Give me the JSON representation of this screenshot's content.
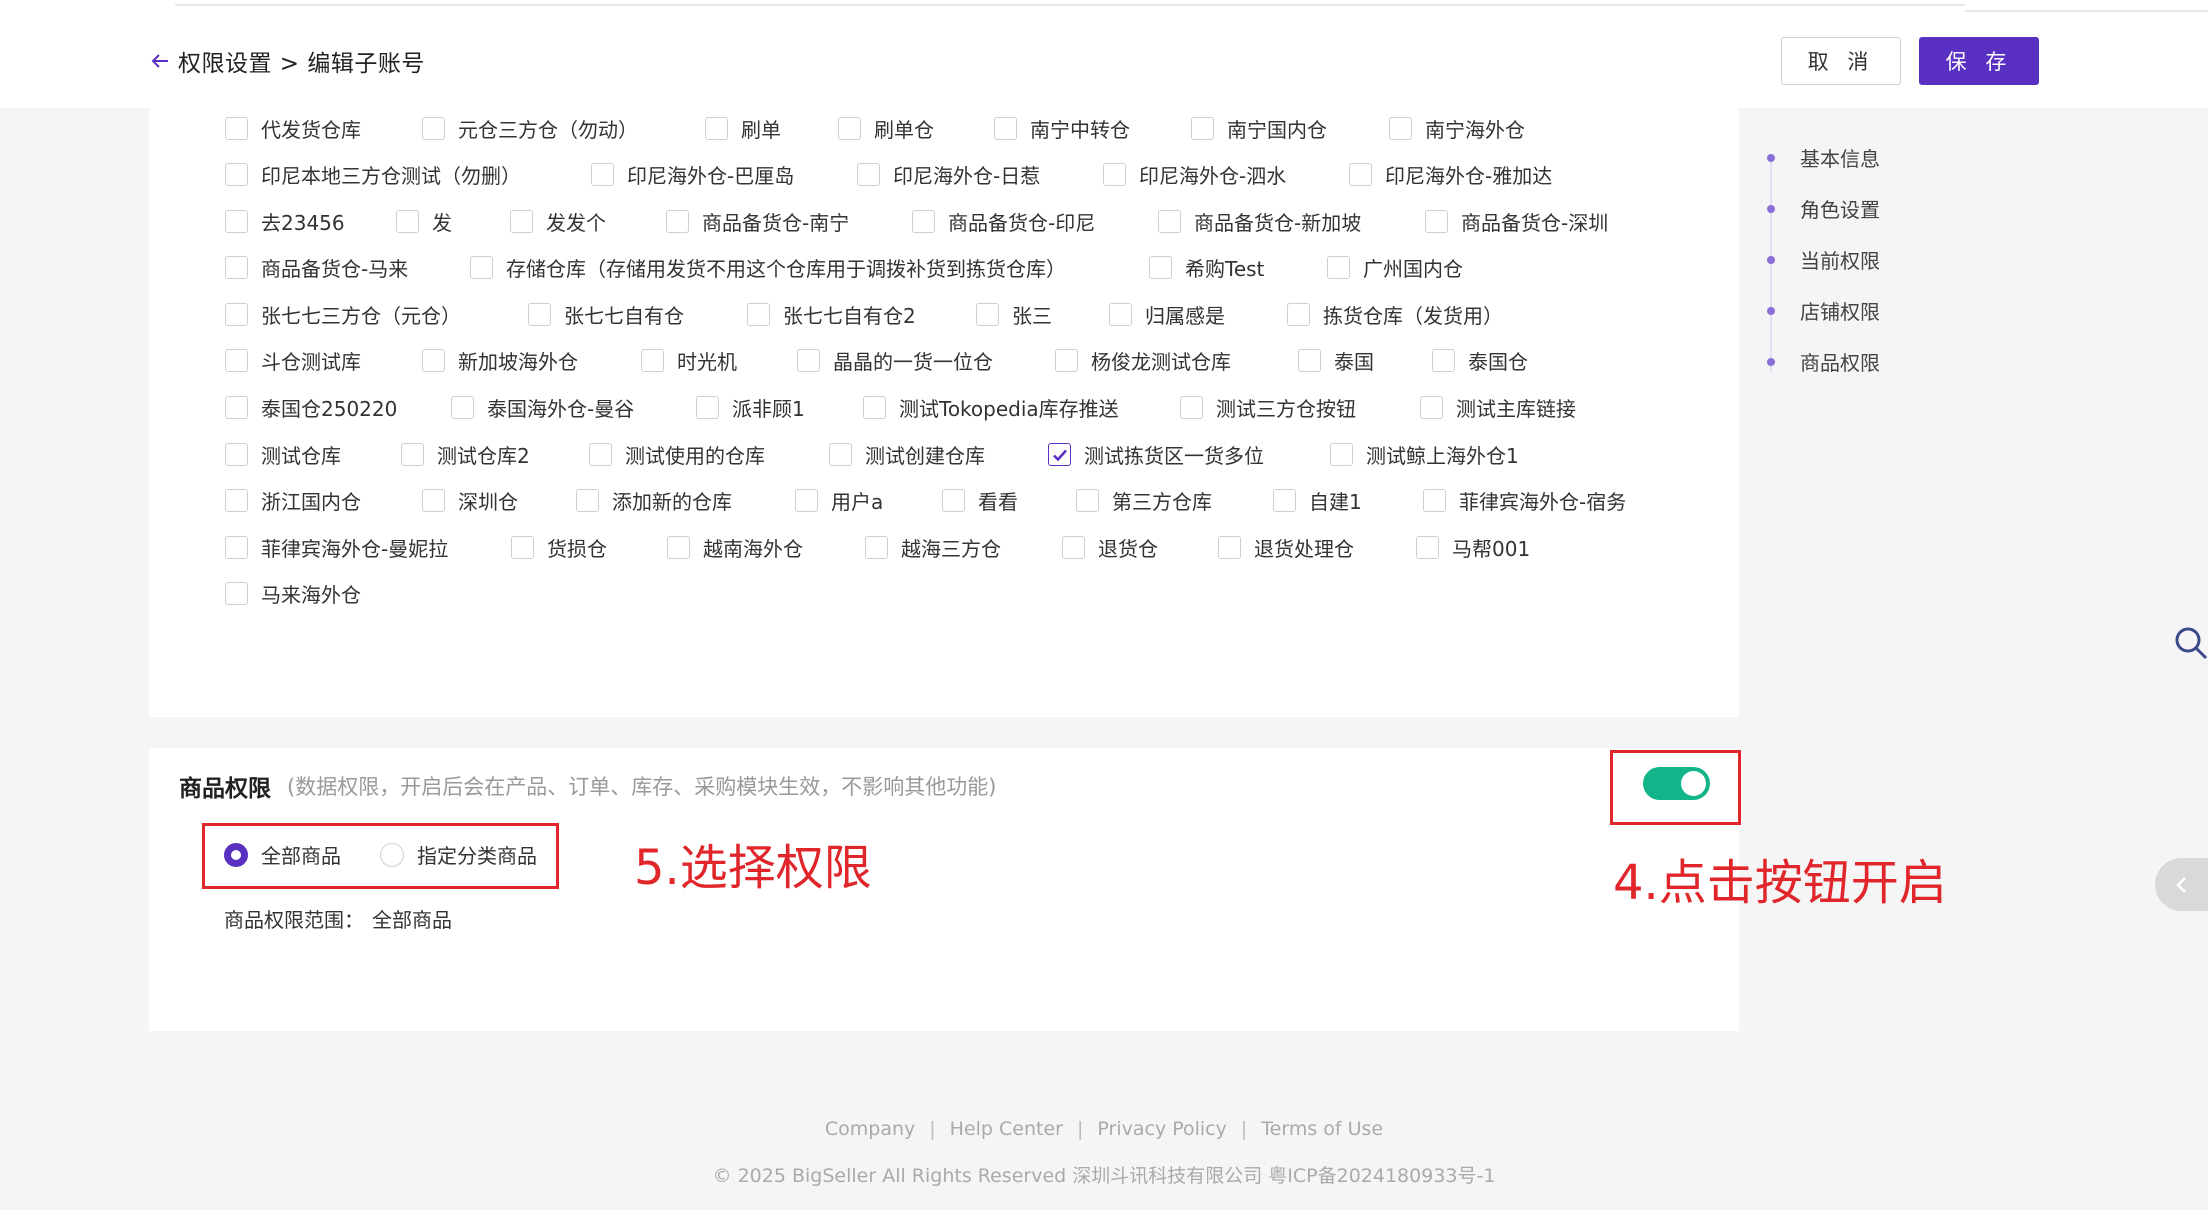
{
  "header": {
    "breadcrumb": "权限设置 > 编辑子账号",
    "cancel_label": "取 消",
    "save_label": "保 存"
  },
  "warehouses": {
    "rows": [
      [
        "代发货仓库",
        "元仓三方仓（勿动）",
        "刷单",
        "刷单仓",
        "南宁中转仓",
        "南宁国内仓",
        "南宁海外仓"
      ],
      [
        "印尼本地三方仓测试（勿删）",
        "印尼海外仓-巴厘岛",
        "印尼海外仓-日惹",
        "印尼海外仓-泗水",
        "印尼海外仓-雅加达"
      ],
      [
        "去23456",
        "发",
        "发发个",
        "商品备货仓-南宁",
        "商品备货仓-印尼",
        "商品备货仓-新加坡",
        "商品备货仓-深圳"
      ],
      [
        "商品备货仓-马来",
        "存储仓库（存储用发货不用这个仓库用于调拨补货到拣货仓库）",
        "希购Test",
        "广州国内仓"
      ],
      [
        "张七七三方仓（元仓）",
        "张七七自有仓",
        "张七七自有仓2",
        "张三",
        "归属感是",
        "拣货仓库（发货用）"
      ],
      [
        "斗仓测试库",
        "新加坡海外仓",
        "时光机",
        "晶晶的一货一位仓",
        "杨俊龙测试仓库",
        "泰国",
        "泰国仓"
      ],
      [
        "泰国仓250220",
        "泰国海外仓-曼谷",
        "派非顾1",
        "测试Tokopedia库存推送",
        "测试三方仓按钮",
        "测试主库链接"
      ],
      [
        "测试仓库",
        "测试仓库2",
        "测试使用的仓库",
        "测试创建仓库",
        "测试拣货区一货多位",
        "测试鲸上海外仓1"
      ],
      [
        "浙江国内仓",
        "深圳仓",
        "添加新的仓库",
        "用户a",
        "看看",
        "第三方仓库",
        "自建1",
        "菲律宾海外仓-宿务"
      ],
      [
        "菲律宾海外仓-曼妮拉",
        "货损仓",
        "越南海外仓",
        "越海三方仓",
        "退货仓",
        "退货处理仓",
        "马帮001"
      ],
      [
        "马来海外仓"
      ]
    ],
    "checked": [
      "测试拣货区一货多位"
    ]
  },
  "side_nav": {
    "items": [
      "基本信息",
      "角色设置",
      "当前权限",
      "店铺权限",
      "商品权限"
    ]
  },
  "product_permission": {
    "title": "商品权限",
    "description": "(数据权限，开启后会在产品、订单、库存、采购模块生效，不影响其他功能)",
    "enabled": true,
    "options": [
      "全部商品",
      "指定分类商品"
    ],
    "selected": "全部商品",
    "range_label": "商品权限范围：",
    "range_value": "全部商品"
  },
  "annotations": {
    "step4": "4.点击按钮开启",
    "step5": "5.选择权限"
  },
  "footer": {
    "links": [
      "Company",
      "Help Center",
      "Privacy Policy",
      "Terms of Use"
    ],
    "copyright": "© 2025 BigSeller All Rights Reserved   深圳斗讯科技有限公司   粤ICP备2024180933号-1"
  },
  "colors": {
    "brand": "#5a30c2",
    "toggle_on": "#12b48a",
    "annotation_red": "#e0262a"
  }
}
